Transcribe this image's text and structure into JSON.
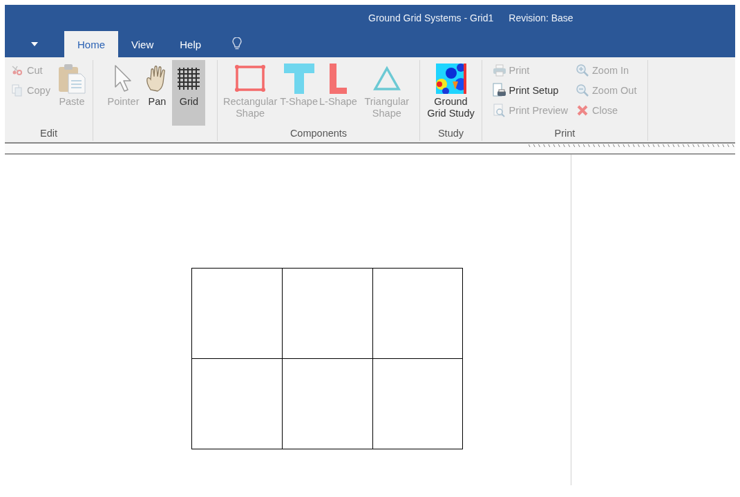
{
  "window": {
    "title": "Ground Grid Systems - Grid1",
    "revision": "Revision: Base"
  },
  "tabs": [
    {
      "label": "Home",
      "selected": true
    },
    {
      "label": "View",
      "selected": false
    },
    {
      "label": "Help",
      "selected": false
    }
  ],
  "ribbon": {
    "groups": [
      {
        "label": "Edit",
        "columns": [
          {
            "kind": "stack",
            "items": [
              {
                "label": "Cut",
                "disabled": true
              },
              {
                "label": "Copy",
                "disabled": true
              }
            ]
          },
          {
            "kind": "large",
            "label": "Paste",
            "disabled": true,
            "selected": false
          }
        ]
      },
      {
        "columns": [
          {
            "kind": "large",
            "label": "Pointer",
            "disabled": true,
            "selected": false
          },
          {
            "kind": "large",
            "label": "Pan",
            "disabled": false,
            "selected": false
          },
          {
            "kind": "large",
            "label": "Grid",
            "disabled": false,
            "selected": true
          }
        ]
      },
      {
        "label": "Components",
        "columns": [
          {
            "kind": "large",
            "label": "Rectangular Shape",
            "disabled": true,
            "selected": false
          },
          {
            "kind": "large",
            "label": "T-Shape",
            "disabled": true,
            "selected": false
          },
          {
            "kind": "large",
            "label": "L-Shape",
            "disabled": true,
            "selected": false
          },
          {
            "kind": "large",
            "label": "Triangular Shape",
            "disabled": true,
            "selected": false
          }
        ]
      },
      {
        "label": "Study",
        "columns": [
          {
            "kind": "large",
            "label": "Ground Grid Study",
            "disabled": false,
            "selected": false
          }
        ]
      },
      {
        "label": "Print",
        "columns": [
          {
            "kind": "stack",
            "items": [
              {
                "label": "Print",
                "disabled": true
              },
              {
                "label": "Print Setup",
                "disabled": false
              },
              {
                "label": "Print Preview",
                "disabled": true
              }
            ]
          },
          {
            "kind": "stack",
            "items": [
              {
                "label": "Zoom In",
                "disabled": true
              },
              {
                "label": "Zoom Out",
                "disabled": true
              },
              {
                "label": "Close",
                "disabled": true
              }
            ]
          }
        ]
      }
    ]
  }
}
